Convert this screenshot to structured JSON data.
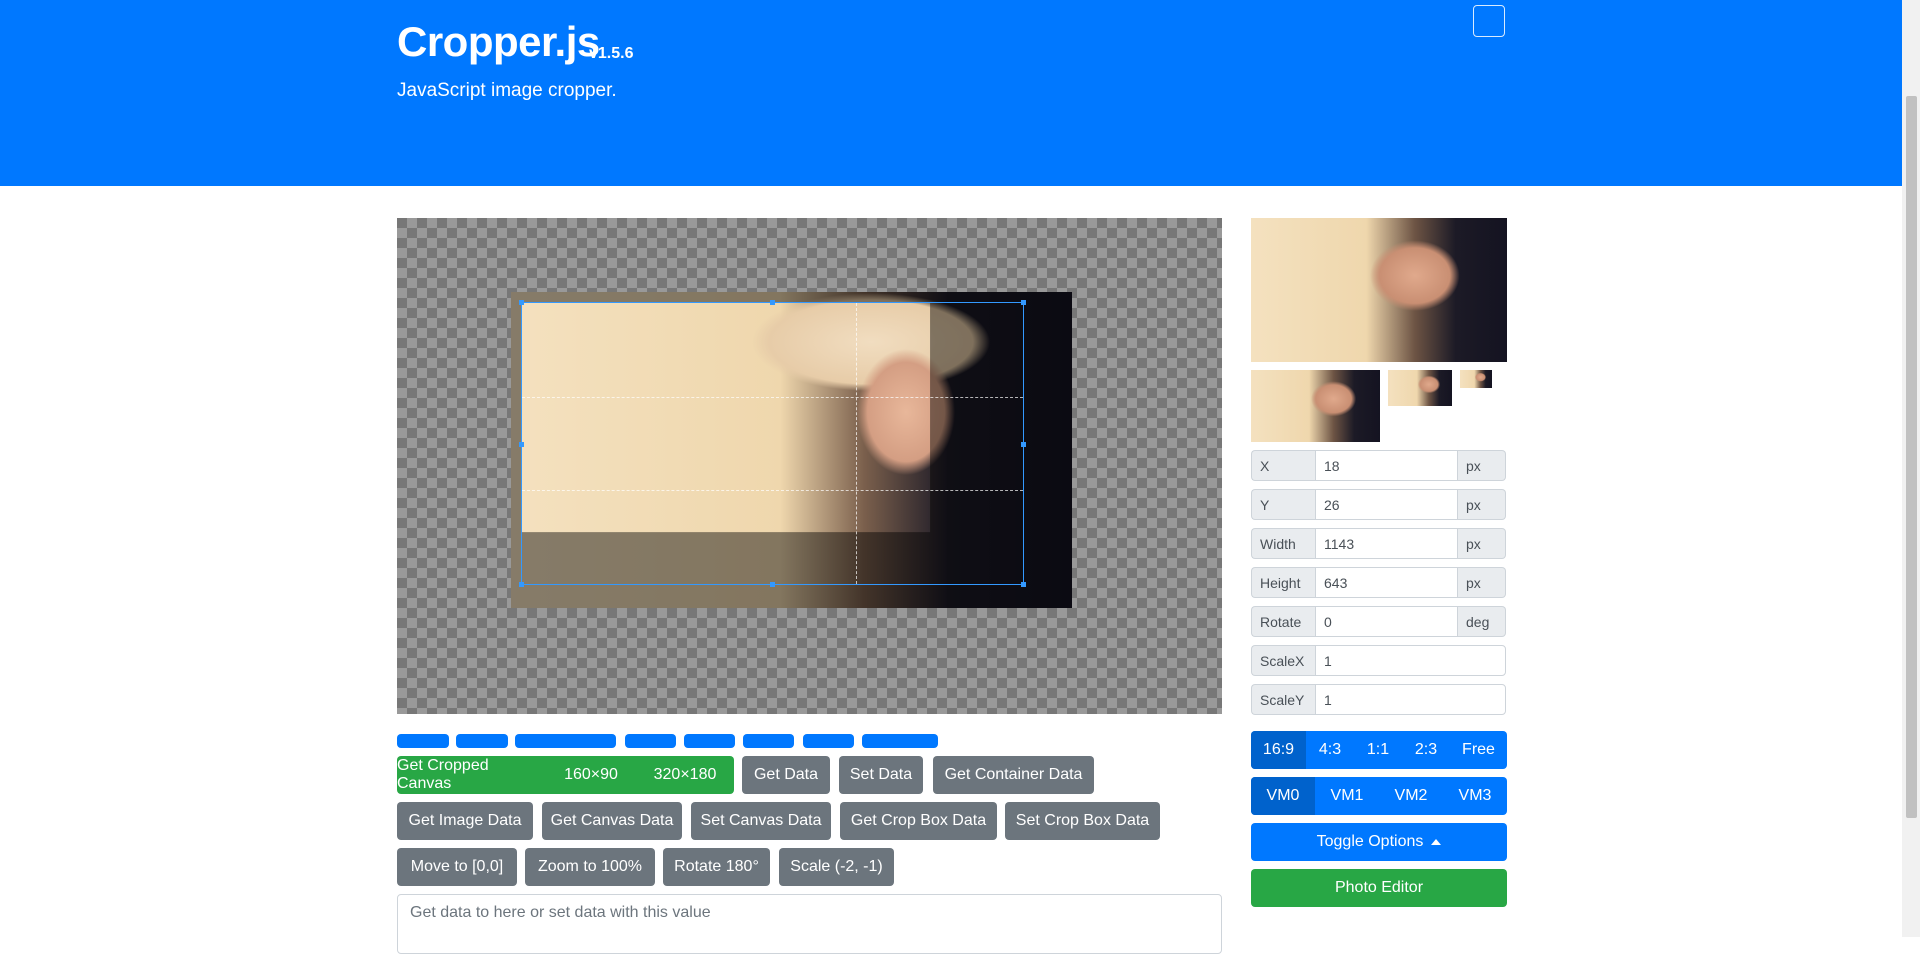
{
  "header": {
    "title": "Cropper.js",
    "version": "v1.5.6",
    "tagline": "JavaScript image cropper.",
    "bg_color": "#0078ff"
  },
  "toolbar": {
    "cropped_canvas": "Get Cropped Canvas",
    "size_160": "160×90",
    "size_320": "320×180",
    "get_data": "Get Data",
    "set_data": "Set Data",
    "get_container_data": "Get Container Data",
    "get_image_data": "Get Image Data",
    "get_canvas_data": "Get Canvas Data",
    "set_canvas_data": "Set Canvas Data",
    "get_crop_box_data": "Get Crop Box Data",
    "set_crop_box_data": "Set Crop Box Data",
    "move_to": "Move to [0,0]",
    "zoom_to": "Zoom to 100%",
    "rotate_180": "Rotate 180°",
    "scale": "Scale (-2, -1)"
  },
  "data_textarea": {
    "placeholder": "Get data to here or set data with this value"
  },
  "data_fields": [
    {
      "label": "X",
      "value": "18",
      "unit": "px"
    },
    {
      "label": "Y",
      "value": "26",
      "unit": "px"
    },
    {
      "label": "Width",
      "value": "1143",
      "unit": "px"
    },
    {
      "label": "Height",
      "value": "643",
      "unit": "px"
    },
    {
      "label": "Rotate",
      "value": "0",
      "unit": "deg"
    },
    {
      "label": "ScaleX",
      "value": "1"
    },
    {
      "label": "ScaleY",
      "value": "1"
    }
  ],
  "aspect_ratios": {
    "selected": "16:9",
    "options": [
      "16:9",
      "4:3",
      "1:1",
      "2:3",
      "Free"
    ]
  },
  "view_modes": {
    "selected": "VM0",
    "options": [
      "VM0",
      "VM1",
      "VM2",
      "VM3"
    ]
  },
  "toggle_options": "Toggle Options",
  "photo_editor": "Photo Editor",
  "colors": {
    "primary": "#0078ff",
    "success": "#28a745",
    "secondary": "#6c757d",
    "crop_border": "#3399ff"
  },
  "icons": {
    "navbar_toggle": "navbar-toggler-icon",
    "caret": "caret-up-icon"
  }
}
